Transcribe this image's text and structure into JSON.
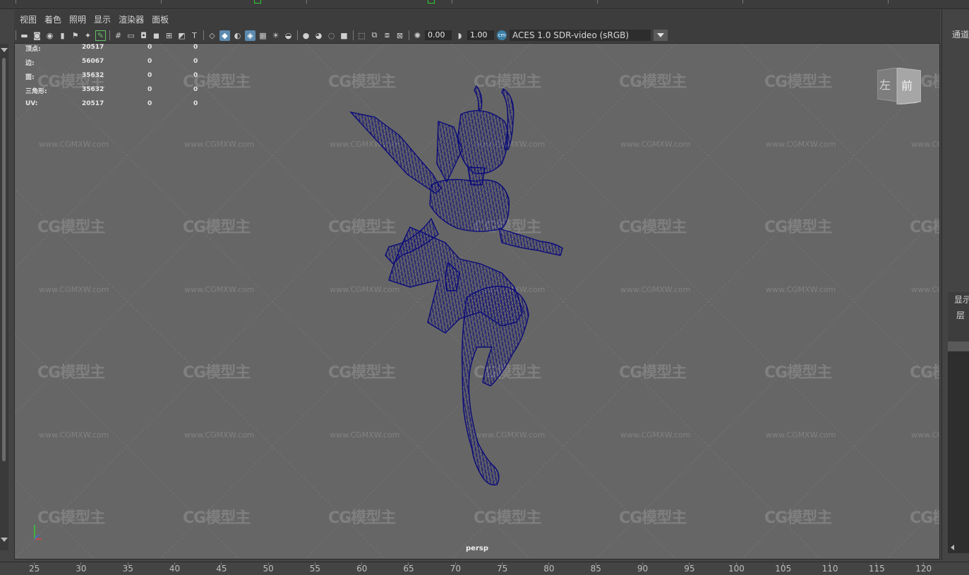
{
  "menu": [
    "视图",
    "着色",
    "照明",
    "显示",
    "渲染器",
    "面板"
  ],
  "toolbar": {
    "exposure_value": "0.00",
    "gamma_value": "1.00",
    "colorspace_badge": "cm",
    "colorspace_label": "ACES 1.0 SDR-video (sRGB)"
  },
  "stats": [
    {
      "label": "顶点:",
      "value": "20517",
      "sel": "0",
      "uv": "0"
    },
    {
      "label": "边:",
      "value": "56067",
      "sel": "0",
      "uv": "0"
    },
    {
      "label": "面:",
      "value": "35632",
      "sel": "0",
      "uv": "0"
    },
    {
      "label": "三角形:",
      "value": "35632",
      "sel": "0",
      "uv": "0"
    },
    {
      "label": "UV:",
      "value": "20517",
      "sel": "0",
      "uv": "0"
    }
  ],
  "viewcube": {
    "left": "左",
    "front": "前"
  },
  "camera_label": "persp",
  "watermark": {
    "logo": "CG模型主",
    "url": "www.CGMXW.com"
  },
  "right_panel": {
    "title": "通道",
    "display": "显示",
    "layer": "层"
  },
  "timeline_numbers": [
    "25",
    "30",
    "35",
    "40",
    "45",
    "50",
    "55",
    "60",
    "65",
    "70",
    "75",
    "80",
    "85",
    "90",
    "95",
    "100",
    "105",
    "110",
    "115",
    "120"
  ],
  "colors": {
    "wireframe": "#0a0a7a",
    "viewport_bg": "#666666",
    "active_tool": "#5d8bb0",
    "key_tick": "#2fcf2f"
  },
  "icons": [
    "camera-icon",
    "select-camera-icon",
    "bookmark-icon",
    "grid-icon",
    "wireframe-cube-icon",
    "smooth-shade-icon",
    "light-icon",
    "shadow-icon",
    "isolate-icon",
    "exposure-icon",
    "gamma-icon"
  ]
}
